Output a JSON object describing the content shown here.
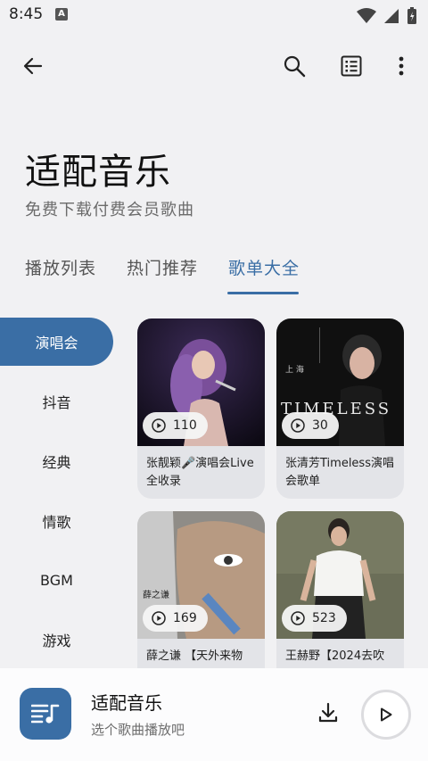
{
  "status_bar": {
    "time": "8:45",
    "notification_letter": "A"
  },
  "app_bar": {
    "icons": [
      "back-arrow-icon",
      "search-icon",
      "list-icon",
      "more-vert-icon"
    ]
  },
  "header": {
    "title": "适配音乐",
    "subtitle": "免费下载付费会员歌曲"
  },
  "tabs": [
    {
      "label": "播放列表",
      "active": false
    },
    {
      "label": "热门推荐",
      "active": false
    },
    {
      "label": "歌单大全",
      "active": true
    }
  ],
  "categories": [
    {
      "label": "演唱会",
      "active": true
    },
    {
      "label": "抖音",
      "active": false
    },
    {
      "label": "经典",
      "active": false
    },
    {
      "label": "情歌",
      "active": false
    },
    {
      "label": "BGM",
      "active": false
    },
    {
      "label": "游戏",
      "active": false
    }
  ],
  "playlists": [
    {
      "title": "张靓颖🎤演唱会Live全收录",
      "plays": "110"
    },
    {
      "title": "张清芳Timeless演唱会歌单",
      "plays": "30",
      "cover_text": "TIMELESS"
    },
    {
      "title": "薛之谦 【天外来物",
      "plays": "169",
      "cover_text": "薛之谦"
    },
    {
      "title": "王赫野【2024去吹",
      "plays": "523"
    }
  ],
  "player": {
    "title": "适配音乐",
    "subtitle": "选个歌曲播放吧"
  },
  "colors": {
    "accent": "#3a6ea5",
    "background": "#f1f1f3"
  }
}
